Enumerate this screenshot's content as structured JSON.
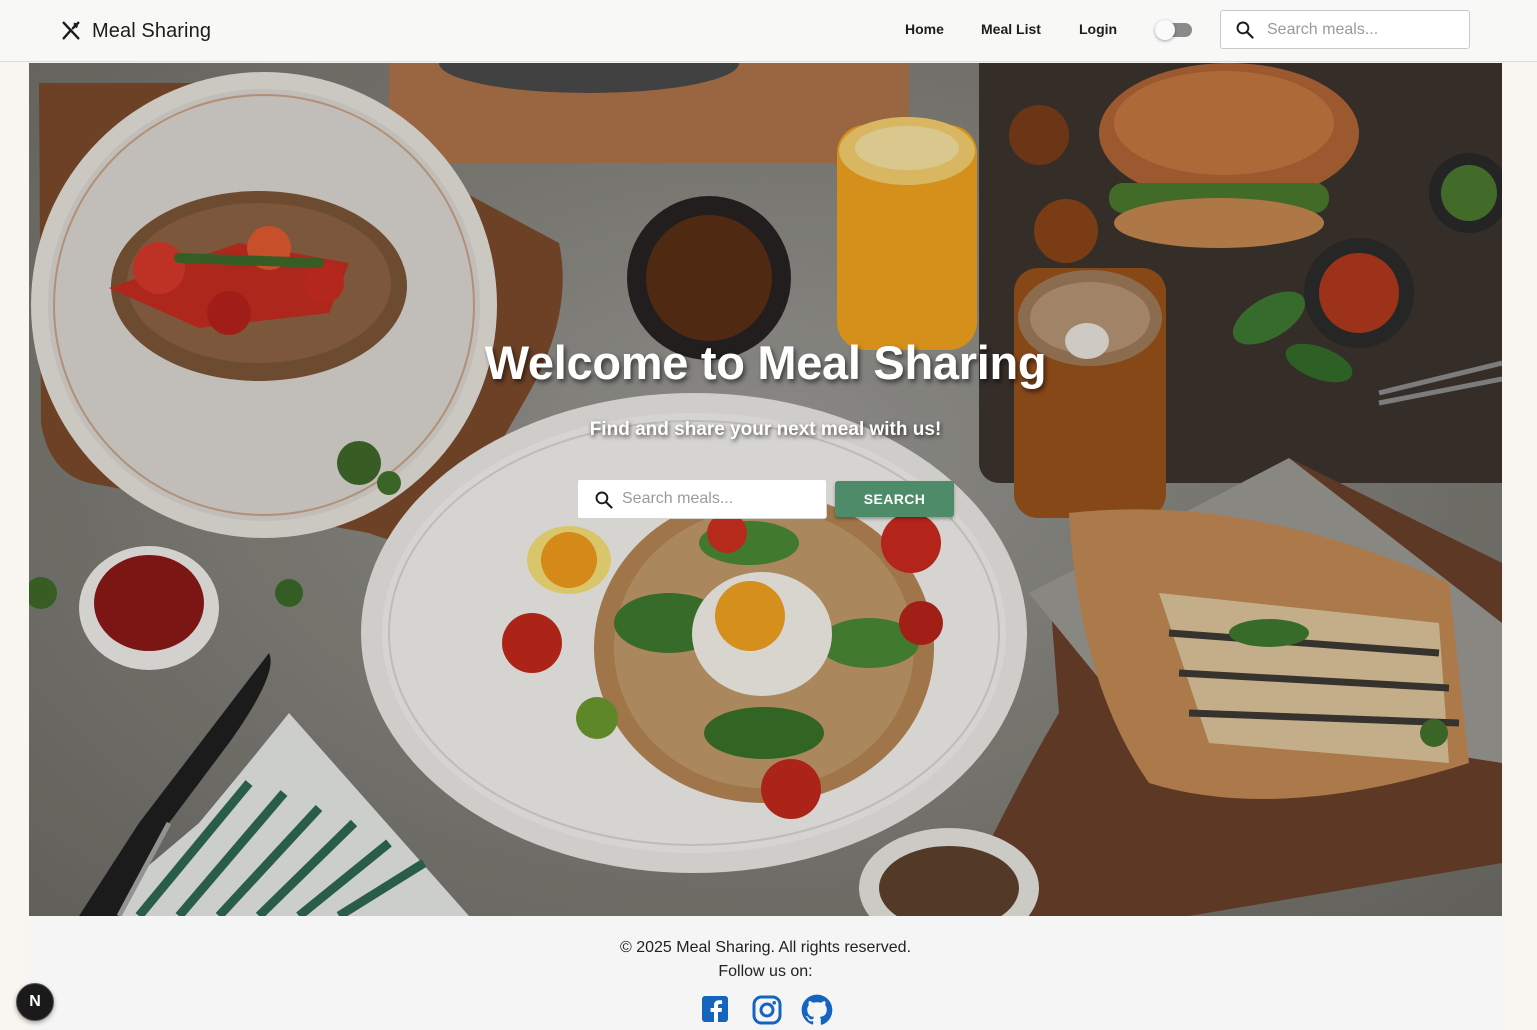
{
  "navbar": {
    "brand": "Meal Sharing",
    "brand_icon": "fork-knife-icon",
    "links": [
      "Home",
      "Meal List",
      "Login"
    ],
    "theme_toggle": {
      "state": "off"
    },
    "search": {
      "placeholder": "Search meals..."
    }
  },
  "hero": {
    "title": "Welcome to Meal Sharing",
    "subtitle": "Find and share your next meal with us!",
    "search": {
      "placeholder": "Search meals...",
      "button": "SEARCH"
    }
  },
  "footer": {
    "copyright": "© 2025 Meal Sharing. All rights reserved.",
    "follow": "Follow us on:",
    "social": [
      "facebook-icon",
      "instagram-icon",
      "github-icon"
    ]
  },
  "dev_badge": "N",
  "colors": {
    "accent_green": "#4e8b69",
    "social_blue": "#1565c0",
    "navbar_bg": "#f8f8f8",
    "footer_bg": "#f5f5f5"
  }
}
